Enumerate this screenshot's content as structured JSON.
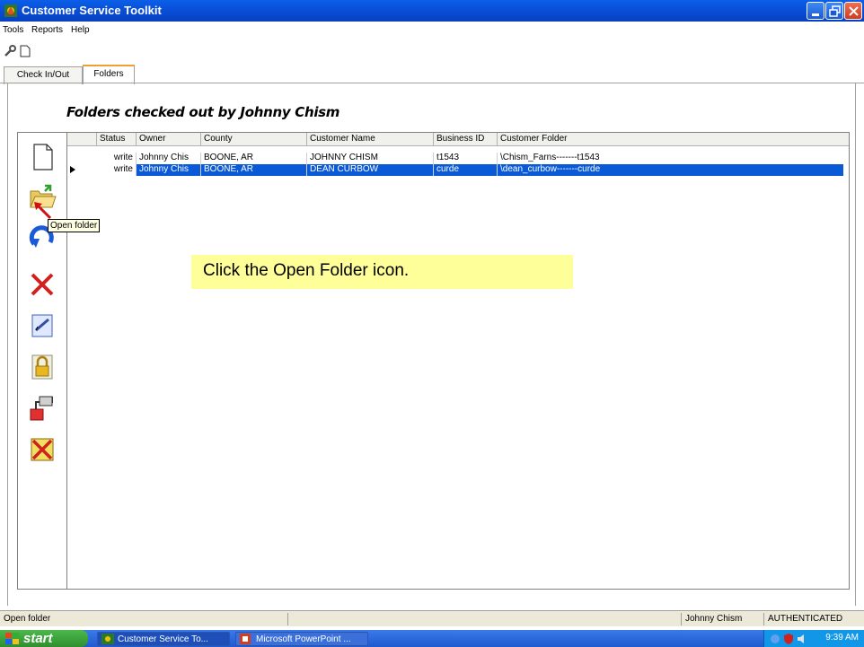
{
  "window": {
    "title": "Customer Service Toolkit"
  },
  "menu": {
    "items": [
      "Tools",
      "Reports",
      "Help"
    ]
  },
  "toolbar": {
    "icons": [
      "wrench-icon",
      "new-document-icon"
    ]
  },
  "tabs": [
    {
      "label": "Check In/Out",
      "active": false
    },
    {
      "label": "Folders",
      "active": true
    }
  ],
  "page": {
    "heading": "Folders checked out by Johnny Chism"
  },
  "grid": {
    "columns": [
      "Status",
      "Owner",
      "County",
      "Customer Name",
      "Business ID",
      "Customer Folder"
    ],
    "rows": [
      {
        "status": "write",
        "owner": "Johnny Chis",
        "county": "BOONE, AR",
        "customer_name": "JOHNNY CHISM",
        "business_id": "t1543",
        "customer_folder": "\\Chism_Farns-------t1543",
        "selected": false
      },
      {
        "status": "write",
        "owner": "Johnny Chis",
        "county": "BOONE, AR",
        "customer_name": "DEAN CURBOW",
        "business_id": "curde",
        "customer_folder": "\\dean_curbow-------curde",
        "selected": true
      }
    ]
  },
  "side_icons": [
    "new-folder-icon",
    "open-folder-icon",
    "refresh-icon",
    "delete-icon",
    "edit-icon",
    "lock-icon",
    "export-icon",
    "cancel-icon"
  ],
  "tooltip": {
    "text": "Open folder"
  },
  "callout": {
    "text": "Click the Open Folder icon."
  },
  "status_bar": {
    "message": "Open folder",
    "user": "Johnny Chism",
    "auth": "AUTHENTICATED"
  },
  "taskbar": {
    "start_label": "start",
    "items": [
      "Customer Service To...",
      "Microsoft PowerPoint ..."
    ],
    "clock": "9:39 AM"
  },
  "colors": {
    "titlebar": "#0a4fd8",
    "selection": "#0a5ad8",
    "callout": "#ffff99",
    "tab_accent": "#f0a030"
  }
}
